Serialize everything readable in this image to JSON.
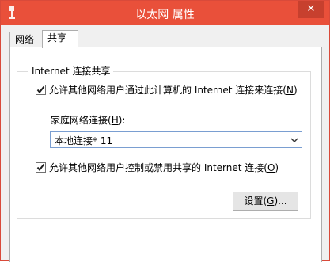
{
  "window": {
    "title": "以太网 属性",
    "close_label": "✕"
  },
  "tabs": [
    {
      "label": "网络"
    },
    {
      "label": "共享"
    }
  ],
  "group": {
    "legend": "Internet 连接共享",
    "allow_sharing": {
      "checked": true,
      "label_main": "允许其他网络用户通过此计算机的 Internet 连接来连接(",
      "label_key": "N",
      "label_end": ")"
    },
    "home_connection": {
      "label_main": "家庭网络连接(",
      "label_key": "H",
      "label_end": "):",
      "value": "本地连接* 11"
    },
    "allow_control": {
      "checked": true,
      "label_main": "允许其他网络用户控制或禁用共享的 Internet 连接(",
      "label_key": "O",
      "label_end": ")"
    },
    "settings_button": {
      "label_main": "设置(",
      "label_key": "G",
      "label_end": ")..."
    }
  },
  "colors": {
    "titlebar": "#e9503a",
    "close_button": "#c7402e",
    "select_border": "#7a9ed1"
  },
  "icons": {
    "titlebar": "network-pin-icon",
    "checkmark": "checkmark-icon",
    "dropdown": "chevron-down-icon",
    "close": "close-icon"
  }
}
